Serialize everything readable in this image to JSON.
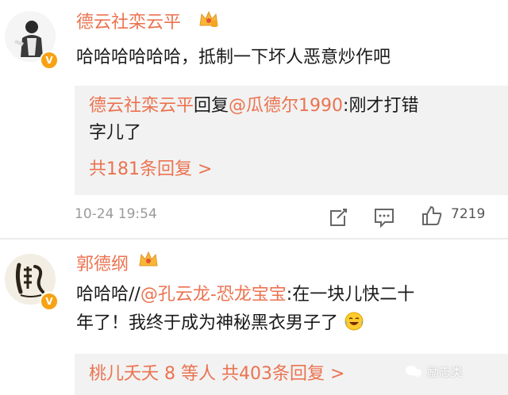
{
  "comments": [
    {
      "username": "德云社栾云平",
      "text": "哈哈哈哈哈哈，抵制一下坏人恶意炒作吧",
      "reply": {
        "user": "德云社栾云平",
        "middle": "回复",
        "mention": "@瓜德尔1990",
        "text_line1_tail": ":刚才打错",
        "text_line2": "字儿了",
        "link": "共181条回复 >"
      },
      "time": "10-24 19:54",
      "likes": "7219"
    },
    {
      "username": "郭德纲",
      "text_prefix": "哈哈哈//",
      "mention": "@孔云龙-恐龙宝宝",
      "text_line1_tail": ":在一块儿快二十",
      "text_line2": "年了！我终于成为神秘黑衣男子了",
      "reply": {
        "link": "桃儿夭夭 8 等人  共403条回复 >"
      }
    }
  ],
  "watermark": "励志类",
  "colors": {
    "accent": "#eb7350",
    "vip_badge": "#f7a215",
    "reply_bg": "#f2f2f2"
  },
  "icons": [
    "crown-icon",
    "verified-badge-icon",
    "share-icon",
    "comment-icon",
    "like-icon",
    "laughing-tears-emoji"
  ]
}
